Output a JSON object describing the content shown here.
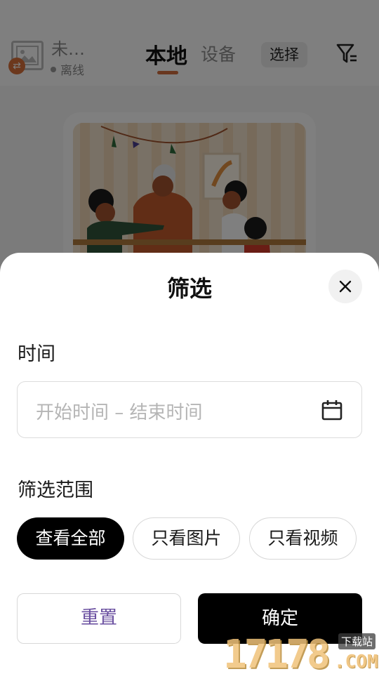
{
  "header": {
    "device_name": "未…",
    "device_status": "离线",
    "tabs": [
      {
        "label": "本地",
        "active": true
      },
      {
        "label": "设备",
        "active": false
      }
    ],
    "select_label": "选择",
    "accent_color": "#d36f3e"
  },
  "sheet": {
    "title": "筛选",
    "time_label": "时间",
    "date_placeholder": "开始时间 – 结束时间",
    "range_label": "筛选范围",
    "chips": [
      {
        "label": "查看全部",
        "selected": true
      },
      {
        "label": "只看图片",
        "selected": false
      },
      {
        "label": "只看视频",
        "selected": false
      }
    ],
    "reset_label": "重置",
    "confirm_label": "确定"
  },
  "watermark": {
    "number": "17178",
    "domain": ".COM",
    "site_label": "下载站"
  }
}
